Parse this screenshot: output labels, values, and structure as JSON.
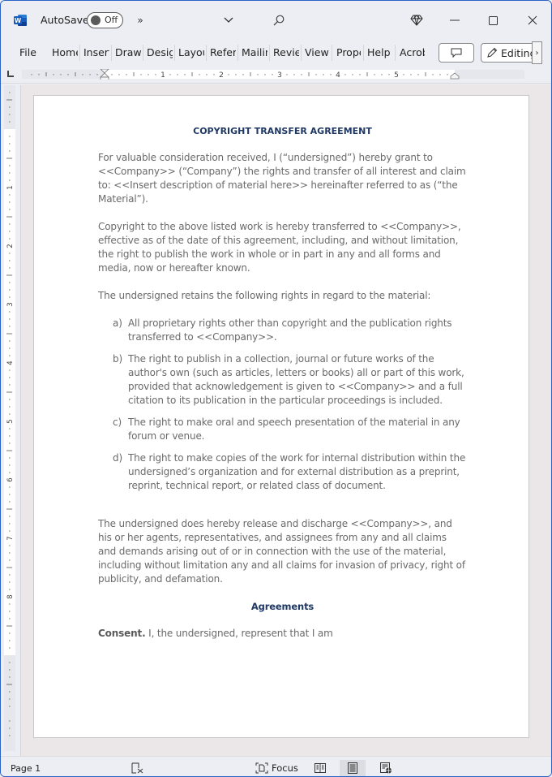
{
  "titlebar": {
    "autosave_label": "AutoSave",
    "autosave_state": "Off",
    "app_icon": "word-logo-icon",
    "icons": [
      "more-commands-icon",
      "customize-dropdown-icon",
      "search-icon",
      "premium-diamond-icon",
      "minimize-icon",
      "maximize-icon",
      "close-icon"
    ],
    "accent_color": "#185abd"
  },
  "ribbon": {
    "tabs": [
      {
        "label": "File"
      },
      {
        "label": "Home"
      },
      {
        "label": "Insert"
      },
      {
        "label": "Draw"
      },
      {
        "label": "Design"
      },
      {
        "label": "Layout"
      },
      {
        "label": "References"
      },
      {
        "label": "Mailings"
      },
      {
        "label": "Review"
      },
      {
        "label": "View"
      },
      {
        "label": "Properties"
      },
      {
        "label": "Help"
      },
      {
        "label": "Acrobat"
      }
    ],
    "comments_icon": "comment-icon",
    "editing_label": "Editing",
    "scroll_icon": "chevron-right-icon"
  },
  "ruler": {
    "horizontal_numbers": [
      "1",
      "2",
      "3",
      "4",
      "5"
    ],
    "vertical_numbers": [
      "1",
      "2",
      "3",
      "4",
      "5",
      "6",
      "7",
      "8"
    ]
  },
  "document": {
    "title": "COPYRIGHT TRANSFER AGREEMENT",
    "paragraphs": [
      "For valuable consideration received, I (“undersigned”) hereby grant to <<Company>> (“Company”) the rights and transfer of all interest and claim to: <<Insert description of material here>> hereinafter referred to as (“the Material”).",
      "Copyright to the above listed work is hereby transferred to <<Company>>, effective as of the date of this agreement, including, and without limitation, the right to publish the work in whole or in part in any and all forms and media, now or hereafter known.",
      "The undersigned retains the following rights in regard to the material:"
    ],
    "list": [
      {
        "marker": "a)",
        "text": "All proprietary rights other than copyright and the publication rights transferred to <<Company>>."
      },
      {
        "marker": "b)",
        "text": "The right to publish in a collection, journal or future works of the author's own (such as articles, letters or books) all or part of this work, provided that acknowledgement is given to <<Company>> and a full citation to its publication in the particular proceedings is included."
      },
      {
        "marker": "c)",
        "text": "The right to make oral and speech presentation of the material in any forum or venue."
      },
      {
        "marker": "d)",
        "text": "The right to make copies of the work for internal distribution within the undersigned’s organization and for external distribution as a preprint, reprint, technical report, or related class of document."
      }
    ],
    "release_paragraph": "The undersigned does hereby release and discharge <<Company>>, and his or her agents, representatives, and assignees from any and all claims and demands arising out of or in connection with the use of the material, including without limitation any and all claims for invasion of privacy, right of publicity, and defamation.",
    "section_heading": "Agreements",
    "consent_lead": "Consent.",
    "consent_text": " I, the undersigned, represent that I am",
    "heading_color": "#1f3864"
  },
  "statusbar": {
    "page_label": "Page 1",
    "proofing_icon": "proofing-icon",
    "focus_label": "Focus",
    "views": [
      "read-mode-icon",
      "print-layout-icon",
      "web-layout-icon"
    ],
    "active_view": "print-layout-icon"
  }
}
